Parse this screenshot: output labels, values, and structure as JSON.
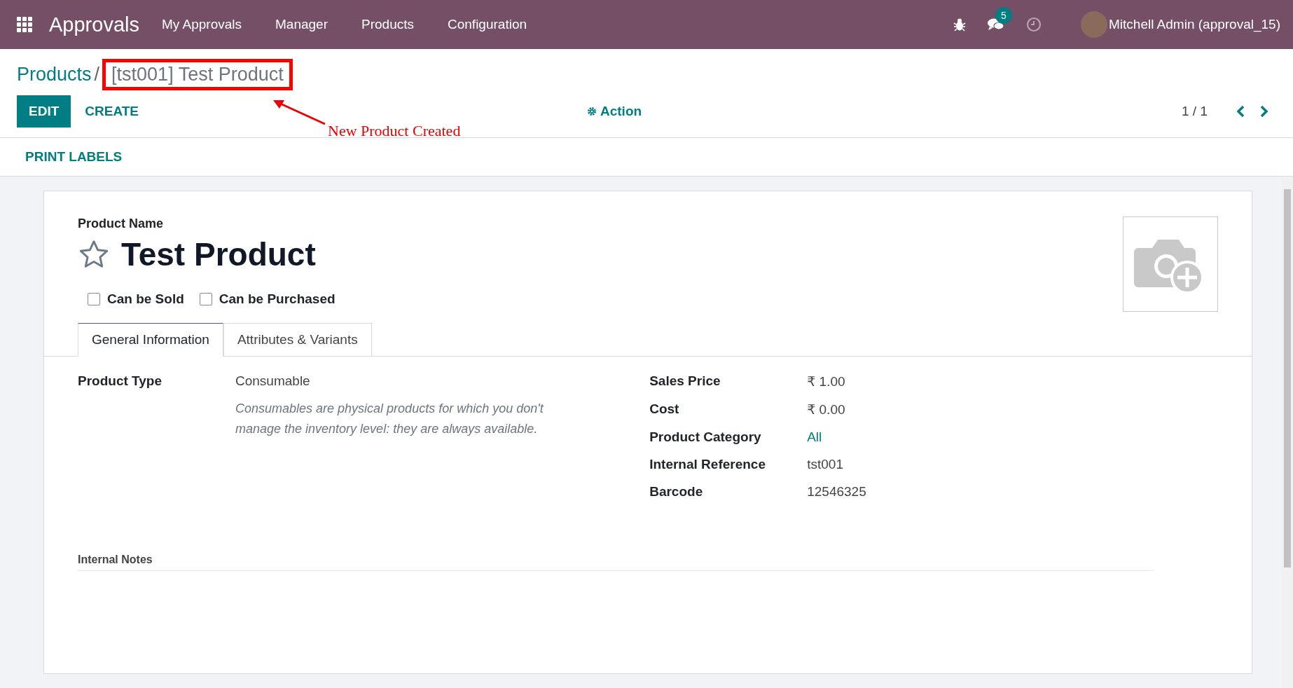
{
  "navbar": {
    "app_name": "Approvals",
    "menu": [
      "My Approvals",
      "Manager",
      "Products",
      "Configuration"
    ],
    "message_count": "5",
    "user": "Mitchell Admin (approval_15)"
  },
  "breadcrumb": {
    "parent": "Products",
    "separator": "/",
    "current": "[tst001] Test Product"
  },
  "annotation": {
    "text": "New Product Created"
  },
  "buttons": {
    "edit": "EDIT",
    "create": "CREATE",
    "action": "Action",
    "print_labels": "PRINT LABELS"
  },
  "pager": "1 / 1",
  "form": {
    "name_label": "Product Name",
    "name": "Test Product",
    "favorite": false,
    "checkboxes": [
      {
        "label": "Can be Sold",
        "checked": false
      },
      {
        "label": "Can be Purchased",
        "checked": false
      }
    ],
    "tabs": [
      {
        "label": "General Information",
        "selected": true
      },
      {
        "label": "Attributes & Variants",
        "selected": false
      }
    ],
    "left_fields": [
      {
        "label": "Product Type",
        "value": "Consumable",
        "help": "Consumables are physical products for which you don't manage the inventory level: they are always available."
      }
    ],
    "right_fields": [
      {
        "label": "Sales Price",
        "value": "₹ 1.00",
        "kind": "text"
      },
      {
        "label": "Cost",
        "value": "₹ 0.00",
        "kind": "text"
      },
      {
        "label": "Product Category",
        "value": "All",
        "kind": "link"
      },
      {
        "label": "Internal Reference",
        "value": "tst001",
        "kind": "text"
      },
      {
        "label": "Barcode",
        "value": "12546325",
        "kind": "text"
      }
    ],
    "notes_label": "Internal Notes"
  }
}
